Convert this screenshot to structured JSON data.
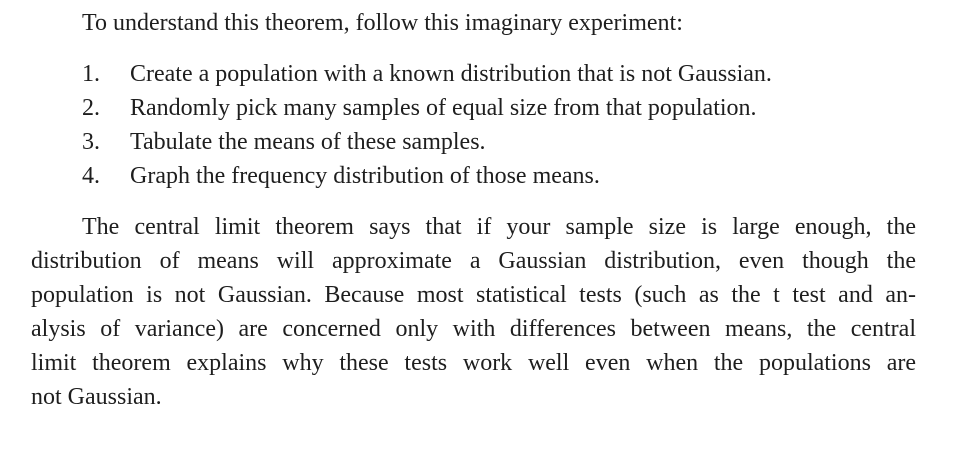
{
  "intro": "To understand this theorem, follow this imaginary experiment:",
  "steps": [
    {
      "number": "1.",
      "text": "Create a population with a known distribution that is not Gaussian."
    },
    {
      "number": "2.",
      "text": "Randomly pick many samples of equal size from that population."
    },
    {
      "number": "3.",
      "text": "Tabulate the means of these samples."
    },
    {
      "number": "4.",
      "text": "Graph the frequency distribution of those means."
    }
  ],
  "paragraph_lines": [
    "The central limit theorem says that if your sample size is large enough, the",
    "distribution of means will approximate a Gaussian distribution, even though the",
    "population is not Gaussian. Because most statistical tests (such as the t test and an-",
    "alysis of variance) are concerned only with differences between means, the central",
    "limit theorem explains why these tests work well even when the populations are",
    "not Gaussian."
  ]
}
